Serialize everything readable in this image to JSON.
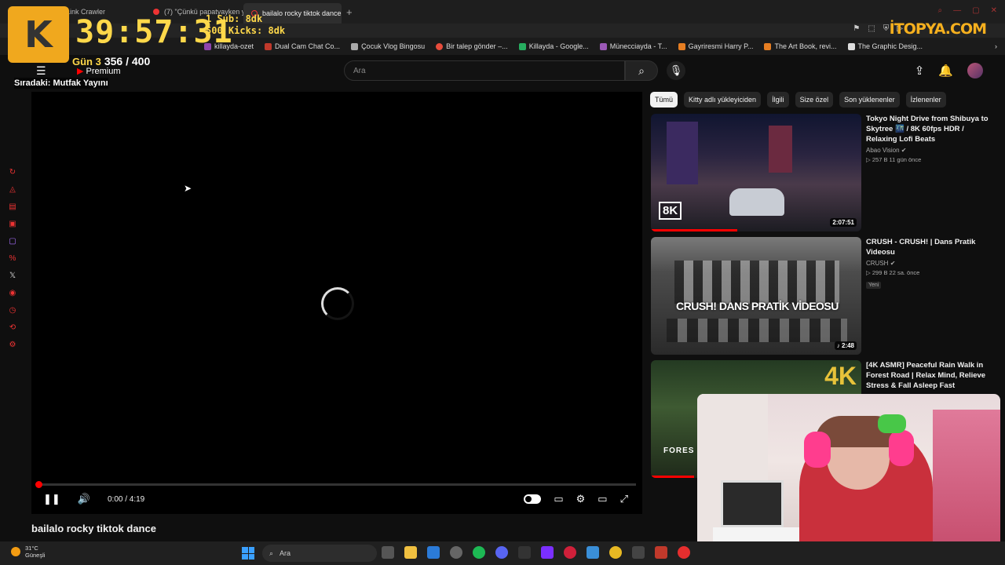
{
  "tabs": [
    {
      "label": "Link Crawler",
      "active": false
    },
    {
      "label": "(7) \"Çünkü papatyayken y",
      "active": false
    },
    {
      "label": "bailalo rocky tiktok dance",
      "active": true
    }
  ],
  "bookmarks": [
    {
      "label": "killayda-ozet",
      "color": "#8e44ad"
    },
    {
      "label": "Dual Cam Chat Co...",
      "color": "#c0392b"
    },
    {
      "label": "Çocuk Vlog Bingosu",
      "color": "#aaaaaa"
    },
    {
      "label": "Bir talep gönder –...",
      "color": "#e74c3c"
    },
    {
      "label": "Killayda - Google...",
      "color": "#27ae60"
    },
    {
      "label": "Münecciayda - T...",
      "color": "#9b59b6"
    },
    {
      "label": "Gayriresmi Harry P...",
      "color": "#e67e22"
    },
    {
      "label": "The Art Book, revi...",
      "color": "#e67e22"
    },
    {
      "label": "The Graphic Desig...",
      "color": "#dddddd"
    }
  ],
  "overlay": {
    "timer": "39:57:31",
    "sub_line": "1 Sub: 8dk",
    "kicks_line": "500 Kicks: 8dk",
    "day": "Gün 3",
    "count": "356 / 400",
    "next": "Sıradaki: Mutfak Yayını",
    "premium": "Premium",
    "brand": "İTOPYA.COM",
    "logo": "K"
  },
  "header": {
    "search_placeholder": "Ara"
  },
  "player": {
    "time": "0:00 / 4:19",
    "title": "bailalo rocky tiktok dance"
  },
  "chips": [
    "Tümü",
    "Kitty adlı yükleyiciden",
    "İlgili",
    "Size özel",
    "Son yüklenenler",
    "İzlenenler"
  ],
  "recommendations": [
    {
      "title": "Tokyo Night Drive from Shibuya to Skytree 🌃 / 8K 60fps HDR / Relaxing Lofi Beats",
      "channel": "Abao Vision",
      "meta": "▷ 257 B  11 gün önce",
      "duration": "2:07:51",
      "tag": "8K"
    },
    {
      "title": "CRUSH - CRUSH! | Dans Pratik Videosu",
      "channel": "CRUSH",
      "meta": "▷ 299 B  22 sa. önce",
      "duration": "♪ 2:48",
      "badge": "Yeni",
      "thumb_text": "CRUSH! DANS PRATİK VİDEOSU"
    },
    {
      "title": "[4K ASMR] Peaceful Rain Walk in Forest Road | Relax Mind, Relieve Stress & Fall Asleep Fast",
      "tag": "4K",
      "thumb_text": "FORES"
    }
  ],
  "taskbar": {
    "temp": "31°C",
    "weather": "Güneşli",
    "search": "Ara"
  },
  "colors": {
    "accent": "#ff0000",
    "overlay_yellow": "#ffd84a",
    "background": "#0f0f0f"
  }
}
